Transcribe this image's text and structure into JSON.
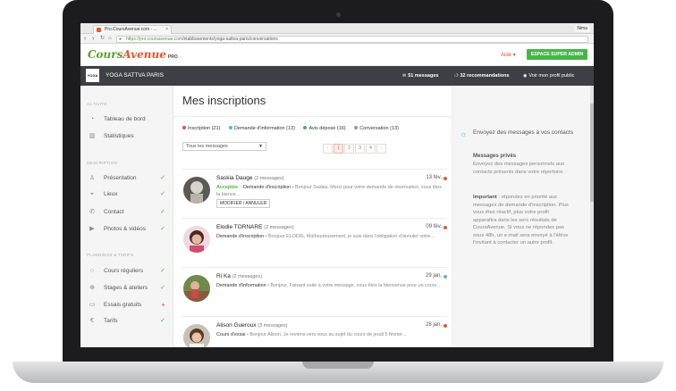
{
  "browser": {
    "tab_title": "Pro.CoursAvenue.com - ...",
    "user": "Nima",
    "url_host": "https://pro.coursavenue.com",
    "url_path": "/etablissements/yoga-sattva-paris/conversations"
  },
  "header": {
    "logo_main": "Cours",
    "logo_accent": "Avenue",
    "logo_pro": "PRO",
    "aide": "Aide ▾",
    "espace_button": "ESPACE SUPER ADMIN"
  },
  "studio": {
    "logo_text": "YOGA",
    "name": "YOGA SATTVA PARIS",
    "messages": "51 messages",
    "recommandations": "32 recommandations",
    "profile_link": "Voir mon profil public"
  },
  "sidebar": {
    "section_activite": "ACTIVITÉ",
    "section_description": "DESCRIPTION",
    "section_planning": "PLANNINGS & TARIFS",
    "items": [
      {
        "label": "Tableau de bord",
        "icon": "dashboard-icon"
      },
      {
        "label": "Statistiques",
        "icon": "stats-icon"
      },
      {
        "label": "Présentation",
        "icon": "user-icon"
      },
      {
        "label": "Lieux",
        "icon": "location-icon"
      },
      {
        "label": "Contact",
        "icon": "phone-icon"
      },
      {
        "label": "Photos & vidéos",
        "icon": "play-icon"
      },
      {
        "label": "Cours réguliers",
        "icon": "circle-icon"
      },
      {
        "label": "Stages & ateliers",
        "icon": "plus-circle-icon"
      },
      {
        "label": "Essais gratuits",
        "icon": "ticket-icon"
      },
      {
        "label": "Tarifs",
        "icon": "euro-icon"
      }
    ]
  },
  "main": {
    "title": "Mes inscriptions",
    "filters": [
      {
        "label": "Inscription (21)",
        "color": "#e8552f"
      },
      {
        "label": "Demande d'information (13)",
        "color": "#57b7d0"
      },
      {
        "label": "Avis déposé (16)",
        "color": "#46b548"
      },
      {
        "label": "Conversation (13)",
        "color": "#999999"
      }
    ],
    "select_value": "Tous les messages",
    "pagination": [
      "‹",
      "1",
      "2",
      "3",
      "4",
      "›"
    ],
    "messages": [
      {
        "name": "Saskia Dauge",
        "count": "(2 messages)",
        "date": "13 fév.",
        "dot_color": "#e8552f",
        "status": "Acceptée",
        "type": "Demande d'inscription",
        "excerpt": "Bonjour Saskia, Merci pour votre demande de réservation, vous êtes la bienve...",
        "button": "MODIFIER / ANNULER"
      },
      {
        "name": "Elodie TORNARE",
        "count": "(2 messages)",
        "date": "09 fév.",
        "dot_color": "#e8552f",
        "status": "",
        "type": "Demande d'inscription",
        "excerpt": "Bonjour ELODIE, Malheureusement, je suis dans l'obligation d'annuler votre...",
        "button": ""
      },
      {
        "name": "Ri Ka",
        "count": "(2 messages)",
        "date": "29 jan.",
        "dot_color": "#57b7d0",
        "status": "",
        "type": "Demande d'information",
        "excerpt": "Bonjour, Faisant suite à votre message, vous êtes la bienvenue pour un cours...",
        "button": ""
      },
      {
        "name": "Alison Gueroux",
        "count": "(3 messages)",
        "date": "28 jan.",
        "dot_color": "#e8552f",
        "status": "",
        "type": "Cours d'essai",
        "excerpt": "Bonjour Alison, Je reviens vers vous au sujet du cours de jeudi 5 février...",
        "button": ""
      }
    ]
  },
  "panel": {
    "title": "Envoyez des messages à vos contacts",
    "head1": "Messages privés",
    "text1": "Envoyez des messages personnels aux contacts présents dans votre répertoire.",
    "head2": "Important",
    "text2": " : répondez en priorité aux messages de demande d'inscription. Plus vous êtes réactif, plus votre profil apparaîtra dans les sers résultats de CoursAvenue. Si vous ne répondez pas sous 48h, un e-mail sera envoyé à l'élève l'invitant à contacter un autre profil."
  }
}
